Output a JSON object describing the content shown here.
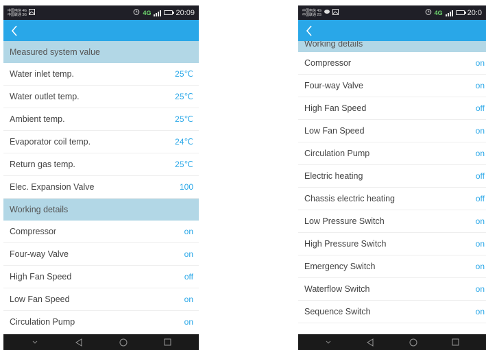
{
  "left_screen": {
    "status_bar": {
      "carrier_line1": "中国电信 4G",
      "carrier_line2": "中国联通 3G",
      "time": "20:09",
      "network": "4G"
    },
    "sections": [
      {
        "title": "Measured system value",
        "rows": [
          {
            "label": "Water inlet temp.",
            "value": "25℃"
          },
          {
            "label": "Water outlet temp.",
            "value": "25℃"
          },
          {
            "label": "Ambient temp.",
            "value": "25℃"
          },
          {
            "label": "Evaporator coil temp.",
            "value": "24℃"
          },
          {
            "label": "Return gas temp.",
            "value": "25℃"
          },
          {
            "label": "Elec. Expansion Valve",
            "value": "100"
          }
        ]
      },
      {
        "title": "Working details",
        "rows": [
          {
            "label": "Compressor",
            "value": "on"
          },
          {
            "label": "Four-way Valve",
            "value": "on"
          },
          {
            "label": "High Fan Speed",
            "value": "off"
          },
          {
            "label": "Low Fan Speed",
            "value": "on"
          },
          {
            "label": "Circulation Pump",
            "value": "on"
          }
        ]
      }
    ]
  },
  "right_screen": {
    "status_bar": {
      "carrier_line1": "中国电信 4G",
      "carrier_line2": "中国联通 2G",
      "time": "20:0",
      "network": "4G"
    },
    "section_title": "Working details",
    "rows": [
      {
        "label": "Compressor",
        "value": "on"
      },
      {
        "label": "Four-way Valve",
        "value": "on"
      },
      {
        "label": "High Fan Speed",
        "value": "off"
      },
      {
        "label": "Low Fan Speed",
        "value": "on"
      },
      {
        "label": "Circulation Pump",
        "value": "on"
      },
      {
        "label": "Electric heating",
        "value": "off"
      },
      {
        "label": "Chassis electric heating",
        "value": "off"
      },
      {
        "label": "Low Pressure Switch",
        "value": "on"
      },
      {
        "label": "High Pressure Switch",
        "value": "on"
      },
      {
        "label": "Emergency Switch",
        "value": "on"
      },
      {
        "label": "Waterflow Switch",
        "value": "on"
      },
      {
        "label": "Sequence Switch",
        "value": "on"
      }
    ]
  },
  "icons": {
    "back": "chevron-left-icon",
    "alarm": "alarm-clock-icon",
    "nav_down": "chevron-down-icon",
    "nav_back": "triangle-back-icon",
    "nav_home": "circle-home-icon",
    "nav_recent": "square-recent-icon"
  },
  "colors": {
    "app_bar": "#29a7e8",
    "section_header": "#b2d7e6",
    "value_text": "#29a7e8",
    "status_bar": "#1f1f27",
    "nav_bar": "#1a1a1a"
  }
}
